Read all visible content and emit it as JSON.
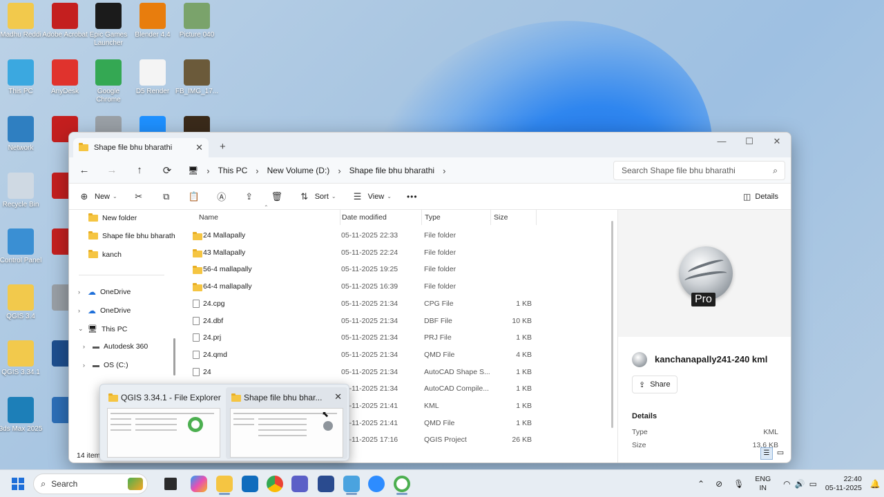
{
  "desktop": {
    "icons": [
      {
        "label": "Madhu Reddi",
        "color": "#f2c94c"
      },
      {
        "label": "Adobe Acrobat",
        "color": "#c41f1f"
      },
      {
        "label": "Epic Games Launcher",
        "color": "#1b1b1b"
      },
      {
        "label": "Blender 4.4",
        "color": "#e87d0d"
      },
      {
        "label": "Picture 040",
        "color": "#7aa36b"
      },
      {
        "label": "This PC",
        "color": "#3ba8e0"
      },
      {
        "label": "AnyDesk",
        "color": "#e0332d"
      },
      {
        "label": "Google Chrome",
        "color": "#34a853"
      },
      {
        "label": "D5 Render",
        "color": "#f4f4f4"
      },
      {
        "label": "FB_IMG_17...",
        "color": "#6b5a3a"
      },
      {
        "label": "Network",
        "color": "#2f7fc1"
      },
      {
        "label": "Recycle Bin",
        "color": "#cfd9e3"
      },
      {
        "label": "Control Panel",
        "color": "#3a8fd3"
      },
      {
        "label": "QGIS 3.4",
        "color": "#f2c94c"
      },
      {
        "label": "QGIS 3.34.1",
        "color": "#f2c94c"
      },
      {
        "label": "3ds Max 2025",
        "color": "#1d7fb8"
      }
    ],
    "icon_glyph_epic": "EPIC",
    "icon_glyph_3ds": "3"
  },
  "window": {
    "tab_title": "Shape file bhu bharathi",
    "tab_close": "✕",
    "new_tab": "+",
    "breadcrumbs": [
      "This PC",
      "New Volume (D:)",
      "Shape file bhu bharathi"
    ],
    "search_placeholder": "Search Shape file bhu bharathi",
    "toolbar": {
      "new_label": "New",
      "sort_label": "Sort",
      "view_label": "View",
      "more_label": "•••",
      "details_label": "Details"
    },
    "sidebar": {
      "items": [
        {
          "label": "New folder",
          "kind": "folder"
        },
        {
          "label": "Shape file bhu bharath",
          "kind": "folder"
        },
        {
          "label": "kanch",
          "kind": "folder"
        },
        {
          "label": "OneDrive",
          "kind": "cloud"
        },
        {
          "label": "OneDrive",
          "kind": "cloud"
        },
        {
          "label": "This PC",
          "kind": "pc"
        },
        {
          "label": "Autodesk 360",
          "kind": "drive"
        },
        {
          "label": "OS (C:)",
          "kind": "drive"
        }
      ]
    },
    "columns": {
      "name": "Name",
      "date": "Date modified",
      "type": "Type",
      "size": "Size"
    },
    "files": [
      {
        "name": "24 Mallapally",
        "date": "05-11-2025 22:33",
        "type": "File folder",
        "size": "",
        "kind": "folder"
      },
      {
        "name": "43 Mallapally",
        "date": "05-11-2025 22:24",
        "type": "File folder",
        "size": "",
        "kind": "folder"
      },
      {
        "name": "56-4 mallapally",
        "date": "05-11-2025 19:25",
        "type": "File folder",
        "size": "",
        "kind": "folder"
      },
      {
        "name": "64-4 mallapally",
        "date": "05-11-2025 16:39",
        "type": "File folder",
        "size": "",
        "kind": "folder"
      },
      {
        "name": "24.cpg",
        "date": "05-11-2025 21:34",
        "type": "CPG File",
        "size": "1 KB",
        "kind": "file"
      },
      {
        "name": "24.dbf",
        "date": "05-11-2025 21:34",
        "type": "DBF File",
        "size": "10 KB",
        "kind": "file"
      },
      {
        "name": "24.prj",
        "date": "05-11-2025 21:34",
        "type": "PRJ File",
        "size": "1 KB",
        "kind": "file"
      },
      {
        "name": "24.qmd",
        "date": "05-11-2025 21:34",
        "type": "QMD File",
        "size": "4 KB",
        "kind": "file"
      },
      {
        "name": "24",
        "date": "05-11-2025 21:34",
        "type": "AutoCAD Shape S...",
        "size": "1 KB",
        "kind": "file"
      },
      {
        "name": "",
        "date": "05-11-2025 21:34",
        "type": "AutoCAD Compile...",
        "size": "1 KB",
        "kind": "hidden"
      },
      {
        "name": "",
        "date": "05-11-2025 21:41",
        "type": "KML",
        "size": "1 KB",
        "kind": "hidden"
      },
      {
        "name": "",
        "date": "05-11-2025 21:41",
        "type": "QMD File",
        "size": "1 KB",
        "kind": "hidden"
      },
      {
        "name": "",
        "date": "05-11-2025 17:16",
        "type": "QGIS Project",
        "size": "26 KB",
        "kind": "hidden"
      }
    ],
    "status_text": "14 item",
    "details_pane": {
      "preview_badge": "Pro",
      "file_name": "kanchanapally241-240 kml",
      "share_label": "Share",
      "section_title": "Details",
      "type_label": "Type",
      "type_value": "KML",
      "size_label": "Size",
      "size_value": "13.6 KB"
    }
  },
  "thumbnails": [
    {
      "title": "QGIS 3.34.1 - File Explorer"
    },
    {
      "title": "Shape file bhu bhar...",
      "close": "✕"
    }
  ],
  "taskbar": {
    "search_label": "Search",
    "lang_top": "ENG",
    "lang_bottom": "IN",
    "time": "22:40",
    "date": "05-11-2025"
  },
  "colors": {
    "accent": "#0067c0",
    "folder": "#f5c542",
    "taskbar": "#e7edf3"
  }
}
